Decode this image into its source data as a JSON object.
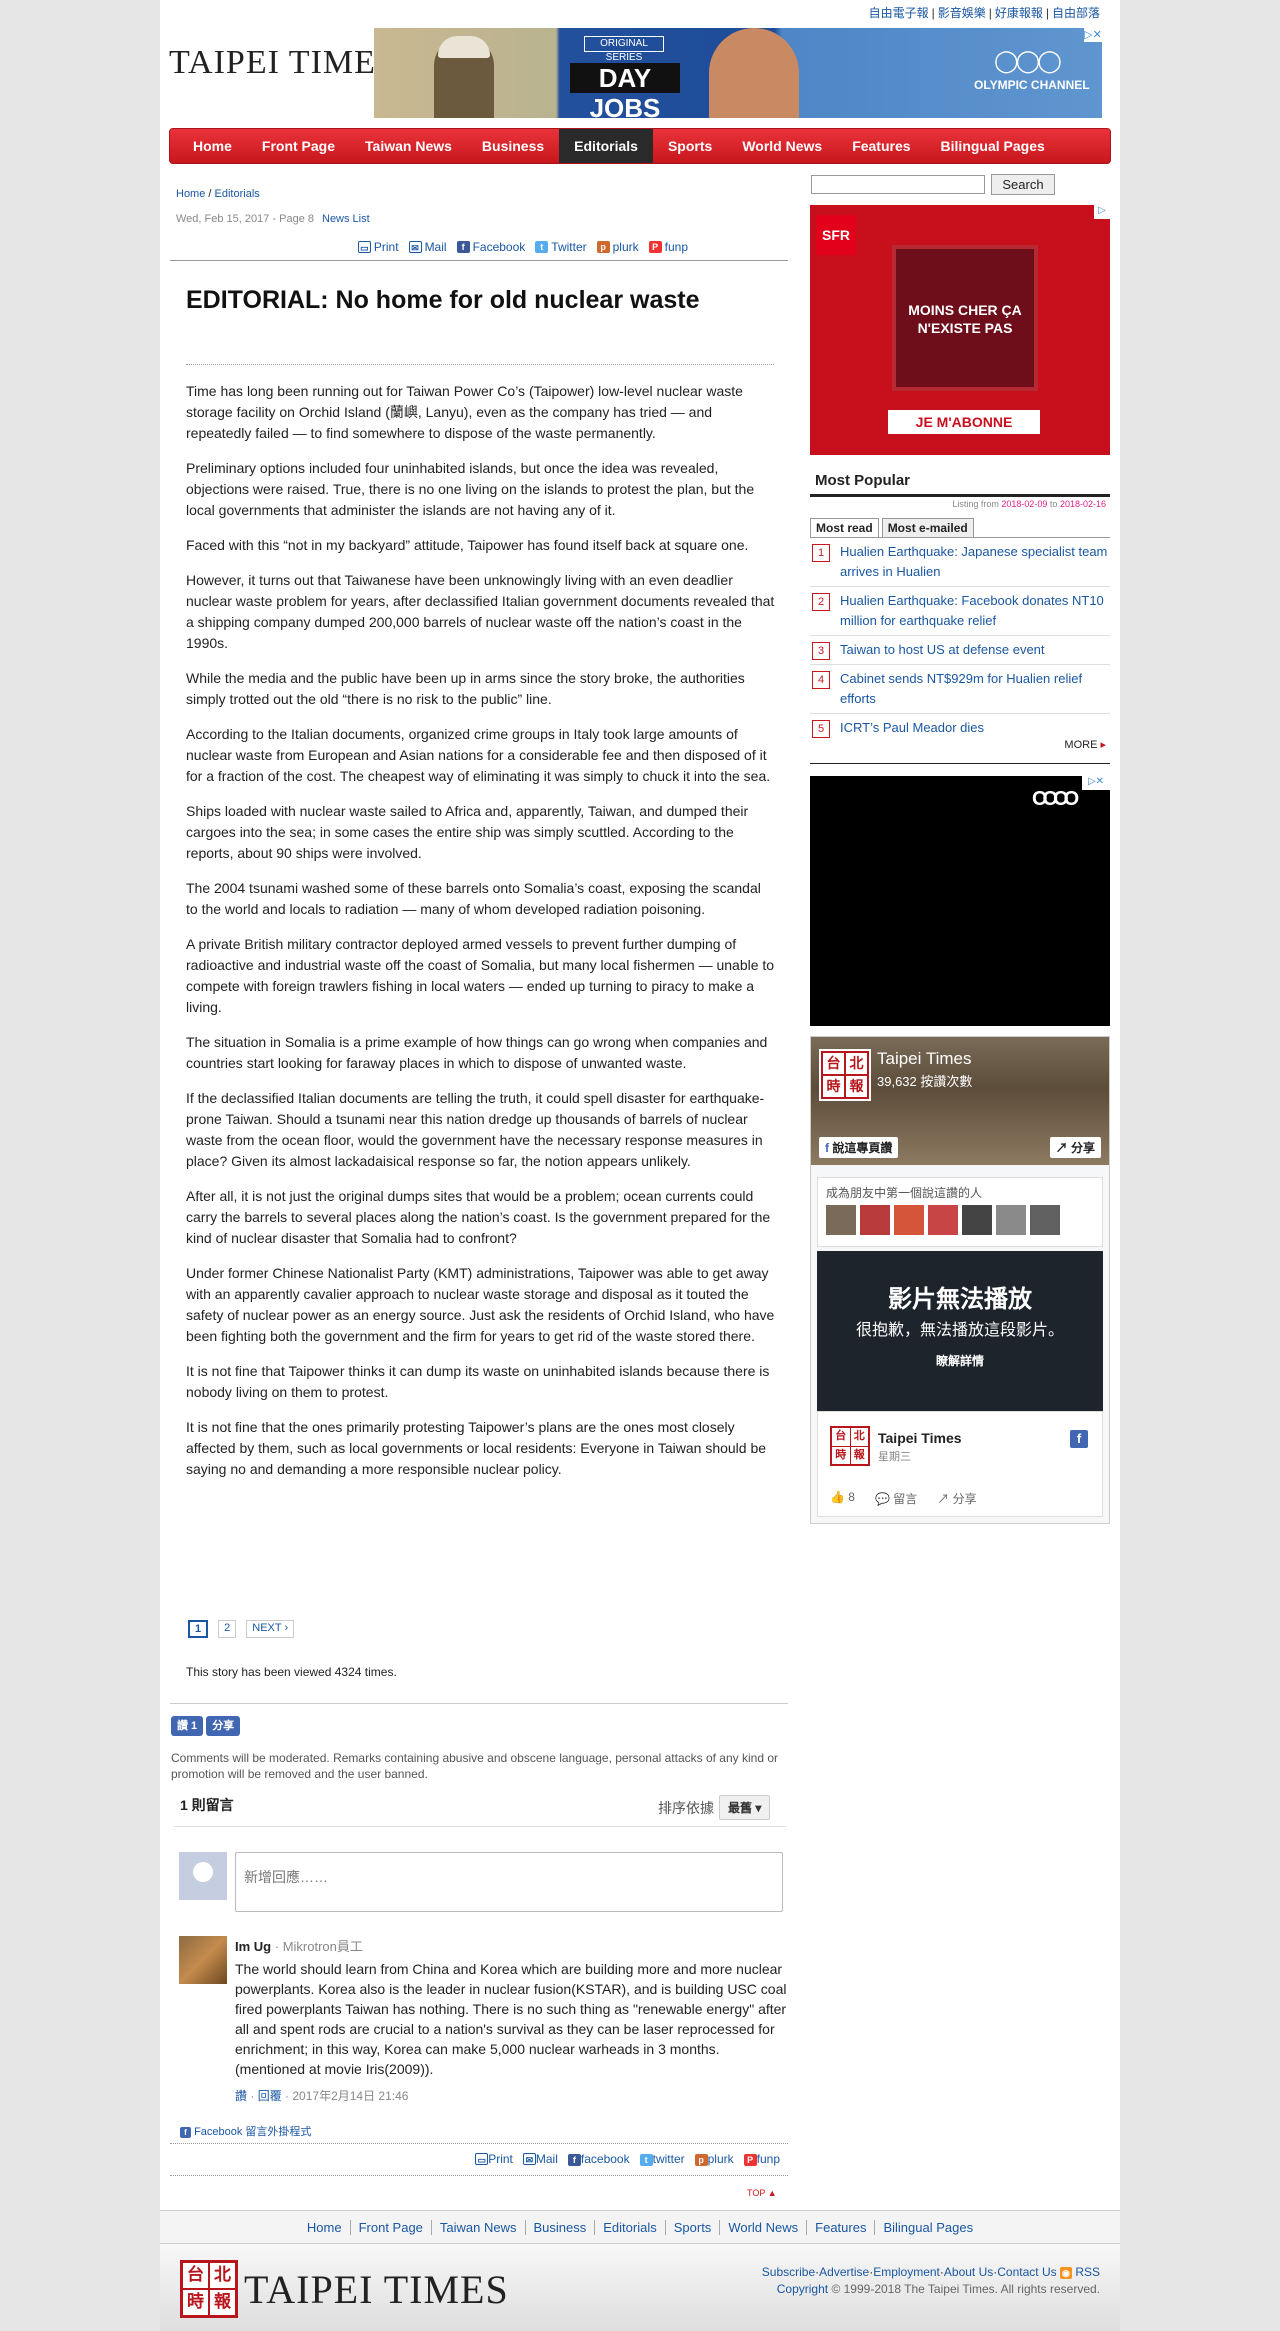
{
  "toplinks": [
    "自由電子報",
    "影音娛樂",
    "好康報報",
    "自由部落"
  ],
  "logo": "TAIPEI TIMES",
  "banner": {
    "brand": "ORIGINAL SERIES",
    "title": "DAY JOBS",
    "channel": "OLYMPIC CHANNEL",
    "close": "▷✕"
  },
  "nav": [
    "Home",
    "Front Page",
    "Taiwan News",
    "Business",
    "Editorials",
    "Sports",
    "World News",
    "Features",
    "Bilingual Pages"
  ],
  "nav_active": "Editorials",
  "breadcrumb": {
    "home": "Home",
    "sep": "/",
    "section": "Editorials"
  },
  "meta": {
    "date": "Wed, Feb 15, 2017 - Page 8",
    "news_list": "News List"
  },
  "tools": {
    "print": "Print",
    "mail": "Mail",
    "facebook": "Facebook",
    "twitter": "Twitter",
    "plurk": "plurk",
    "funp": "funp"
  },
  "tools2": {
    "print": "Print",
    "mail": "Mail",
    "facebook": "facebook",
    "twitter": "twitter",
    "plurk": "plurk",
    "funp": "funp"
  },
  "article": {
    "title": "EDITORIAL: No home for old nuclear waste",
    "paragraphs": [
      "Time has long been running out for Taiwan Power Co’s (Taipower) low-level nuclear waste storage facility on Orchid Island (蘭嶼, Lanyu), even as the company has tried — and repeatedly failed — to find somewhere to dispose of the waste permanently.",
      "Preliminary options included four uninhabited islands, but once the idea was revealed, objections were raised. True, there is no one living on the islands to protest the plan, but the local governments that administer the islands are not having any of it.",
      "Faced with this “not in my backyard” attitude, Taipower has found itself back at square one.",
      "However, it turns out that Taiwanese have been unknowingly living with an even deadlier nuclear waste problem for years, after declassified Italian government documents revealed that a shipping company dumped 200,000 barrels of nuclear waste off the nation’s coast in the 1990s.",
      "While the media and the public have been up in arms since the story broke, the authorities simply trotted out the old “there is no risk to the public” line.",
      "According to the Italian documents, organized crime groups in Italy took large amounts of nuclear waste from European and Asian nations for a considerable fee and then disposed of it for a fraction of the cost. The cheapest way of eliminating it was simply to chuck it into the sea.",
      "Ships loaded with nuclear waste sailed to Africa and, apparently, Taiwan, and dumped their cargoes into the sea; in some cases the entire ship was simply scuttled. According to the reports, about 90 ships were involved.",
      "The 2004 tsunami washed some of these barrels onto Somalia’s coast, exposing the scandal to the world and locals to radiation — many of whom developed radiation poisoning.",
      "A private British military contractor deployed armed vessels to prevent further dumping of radioactive and industrial waste off the coast of Somalia, but many local fishermen — unable to compete with foreign trawlers fishing in local waters — ended up turning to piracy to make a living.",
      "The situation in Somalia is a prime example of how things can go wrong when companies and countries start looking for faraway places in which to dispose of unwanted waste.",
      "If the declassified Italian documents are telling the truth, it could spell disaster for earthquake-prone Taiwan. Should a tsunami near this nation dredge up thousands of barrels of nuclear waste from the ocean floor, would the government have the necessary response measures in place? Given its almost lackadaisical response so far, the notion appears unlikely.",
      "After all, it is not just the original dumps sites that would be a problem; ocean currents could carry the barrels to several places along the nation’s coast. Is the government prepared for the kind of nuclear disaster that Somalia had to confront?",
      "Under former Chinese Nationalist Party (KMT) administrations, Taipower was able to get away with an apparently cavalier approach to nuclear waste storage and disposal as it touted the safety of nuclear power as an energy source. Just ask the residents of Orchid Island, who have been fighting both the government and the firm for years to get rid of the waste stored there.",
      "It is not fine that Taipower thinks it can dump its waste on uninhabited islands because there is nobody living on them to protest.",
      "It is not fine that the ones primarily protesting Taipower’s plans are the ones most closely affected by them, such as local governments or local residents: Everyone in Taiwan should be saying no and demanding a more responsible nuclear policy."
    ],
    "pages": [
      "1",
      "2",
      "NEXT ›"
    ],
    "views": "This story has been viewed 4324 times."
  },
  "fb_buttons": {
    "like": "讚 1",
    "share": "分享"
  },
  "comments": {
    "moderation": "Comments will be moderated. Remarks containing abusive and obscene language, personal attacks of any kind or promotion will be removed and the user banned.",
    "count": "1 則留言",
    "sort_label": "排序依據",
    "sort_value": "最舊 ▾",
    "placeholder": "新增回應……",
    "items": [
      {
        "name": "Im Ug",
        "affiliation": "· Mikrotron員工",
        "text": "The world should learn from China and Korea which are building more and more nuclear powerplants. Korea also is the leader in nuclear fusion(KSTAR), and is building USC coal fired powerplants Taiwan has nothing. There is no such thing as \"renewable energy\" after all and spent rods are crucial to a nation's survival as they can be laser reprocessed for enrichment; in this way, Korea can make 5,000 nuclear warheads in 3 months.(mentioned at movie Iris(2009)).",
        "like": "讚",
        "reply": "回覆",
        "date": "· 2017年2月14日 21:46"
      }
    ],
    "plugin": "Facebook 留言外掛程式"
  },
  "top": "TOP",
  "footer_nav": [
    "Home",
    "Front Page",
    "Taiwan News",
    "Business",
    "Editorials",
    "Sports",
    "World News",
    "Features",
    "Bilingual Pages"
  ],
  "footer": {
    "logo": "TAIPEI TIMES",
    "seal": [
      "台",
      "北",
      "時",
      "報"
    ],
    "links": [
      "Subscribe",
      "Advertise",
      "Employment",
      "About Us",
      "Contact Us"
    ],
    "rss": "RSS",
    "copyright_link": "Copyright",
    "copyright": "© 1999-2018 The Taipei Times. All rights reserved."
  },
  "sidebar": {
    "search_button": "Search",
    "ad_sfr": {
      "brand": "SFR",
      "text": "MOINS CHER ÇA N'EXISTE PAS",
      "button": "JE M'ABONNE",
      "close": "▷"
    },
    "most_popular": {
      "title": "Most Popular",
      "listing_prefix": "Listing from",
      "from": "2018-02-09",
      "to_word": "to",
      "to": "2018-02-16",
      "tabs": [
        "Most read",
        "Most e-mailed"
      ],
      "items": [
        "Hualien Earthquake: Japanese specialist team arrives in Hualien",
        "Hualien Earthquake: Facebook donates NT10 million for earthquake relief",
        "Taiwan to host US at defense event",
        "Cabinet sends NT$929m for Hualien relief efforts",
        "ICRT’s Paul Meador dies"
      ],
      "more": "MORE"
    },
    "ad_audi": {
      "close": "▷✕",
      "rings": "OOOO"
    },
    "fb_widget": {
      "page_name": "Taipei Times",
      "likes": "39,632 按讚次數",
      "like_btn": "說這專頁讚",
      "share_btn": "分享",
      "friends_text": "成為朋友中第一個說這讚的人",
      "video_title": "影片無法播放",
      "video_sub": "很抱歉，無法播放這段影片。",
      "video_link": "瞭解詳情",
      "post_name": "Taipei Times",
      "post_date": "星期三",
      "post_likes": "8",
      "post_comment": "留言",
      "post_share": "分享"
    }
  },
  "colors": {
    "nav_red": "#c8161d",
    "link_blue": "#1a57a3",
    "date_pink": "#e0208c",
    "fb_blue": "#4267b2"
  }
}
